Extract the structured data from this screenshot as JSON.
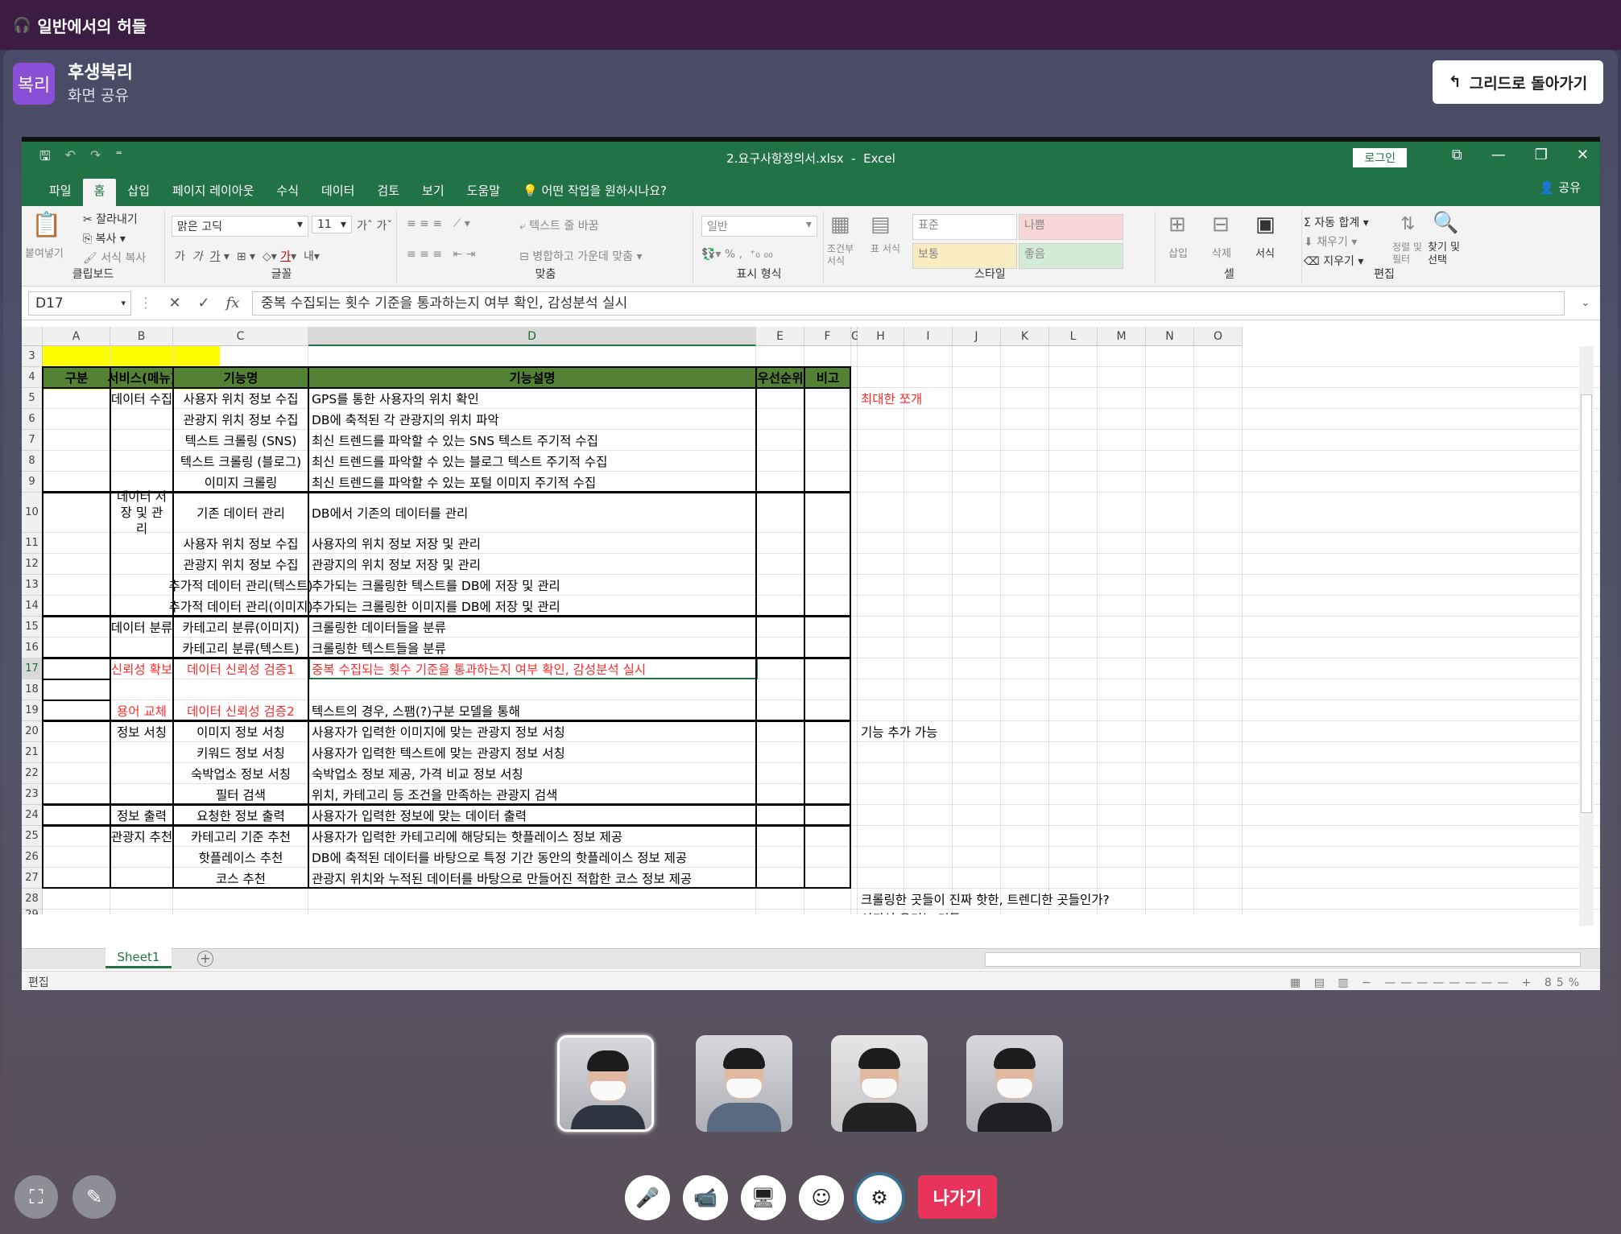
{
  "meeting": {
    "channel_title": "일반에서의 허들",
    "presenter_avatar": "복리",
    "presenter_name": "후생복리",
    "presenter_sub": "화면 공유",
    "back_button": "그리드로 돌아가기",
    "leave_button": "나가기"
  },
  "excel": {
    "filename": "2.요구사항정의서.xlsx",
    "app": "Excel",
    "login": "로그인",
    "tabs": [
      "파일",
      "홈",
      "삽입",
      "페이지 레이아웃",
      "수식",
      "데이터",
      "검토",
      "보기",
      "도움말"
    ],
    "active_tab": "홈",
    "tell_me": "어떤 작업을 원하시나요?",
    "share": "공유",
    "ribbon": {
      "paste": "붙여넣기",
      "cut": "잘라내기",
      "copy": "복사",
      "format_painter": "서식 복사",
      "font_name": "맑은 고딕",
      "font_size": "11",
      "wrap": "텍스트 줄 바꿈",
      "merge": "병합하고 가운데 맞춤",
      "number_format": "일반",
      "cond_format": "조건부 서식",
      "table_format": "표 서식",
      "styles": [
        "표준",
        "나쁨",
        "보통",
        "좋음"
      ],
      "insert": "삽입",
      "delete": "삭제",
      "format": "서식",
      "autosum": "자동 합계",
      "fill": "채우기",
      "clear": "지우기",
      "sort": "정렬 및 필터",
      "find": "찾기 및 선택",
      "groups": [
        "클립보드",
        "글꼴",
        "맞춤",
        "표시 형식",
        "스타일",
        "셀",
        "편집"
      ]
    },
    "name_box": "D17",
    "formula": "중복 수집되는 횟수 기준을 통과하는지 여부 확인, 감성분석 실시",
    "columns": [
      "A",
      "B",
      "C",
      "D",
      "E",
      "F",
      "G",
      "H",
      "I",
      "J",
      "K",
      "L",
      "M",
      "N",
      "O"
    ],
    "rows": [
      "3",
      "4",
      "5",
      "6",
      "7",
      "8",
      "9",
      "10",
      "11",
      "12",
      "13",
      "14",
      "15",
      "16",
      "17",
      "18",
      "19",
      "20",
      "21",
      "22",
      "23",
      "24",
      "25",
      "26",
      "27",
      "28",
      "29"
    ],
    "headers": [
      "구분",
      "서비스(메뉴)",
      "기능명",
      "기능설명",
      "우선순위",
      "비고"
    ],
    "categories": [
      {
        "label": "데이터 수집"
      },
      {
        "label": "데이터 저장 및 관리"
      },
      {
        "label": "데이터 분류"
      },
      {
        "label": "신뢰성 확보"
      },
      {
        "label": "용어 교체"
      },
      {
        "label": "정보 서칭"
      },
      {
        "label": "정보 출력"
      },
      {
        "label": "관광지 추천"
      }
    ],
    "features": [
      {
        "name": "사용자 위치 정보 수집",
        "desc": "GPS를 통한 사용자의 위치 확인"
      },
      {
        "name": "관광지 위치 정보 수집",
        "desc": "DB에 축적된 각 관광지의 위치 파악"
      },
      {
        "name": "텍스트 크롤링 (SNS)",
        "desc": "최신 트렌드를 파악할 수 있는 SNS 텍스트 주기적 수집"
      },
      {
        "name": "텍스트 크롤링 (블로그)",
        "desc": "최신 트렌드를 파악할 수 있는 블로그 텍스트 주기적 수집"
      },
      {
        "name": "이미지 크롤링",
        "desc": "최신 트렌드를 파악할 수 있는 포털 이미지 주기적 수집"
      },
      {
        "name": "기존 데이터 관리",
        "desc": "DB에서 기존의 데이터를 관리"
      },
      {
        "name": "사용자 위치 정보 수집",
        "desc": "사용자의 위치 정보 저장 및 관리"
      },
      {
        "name": "관광지 위치 정보 수집",
        "desc": "관광지의 위치 정보 저장 및 관리"
      },
      {
        "name": "추가적 데이터 관리(텍스트)",
        "desc": "추가되는 크롤링한 텍스트를 DB에 저장 및 관리"
      },
      {
        "name": "추가적 데이터 관리(이미지)",
        "desc": "추가되는 크롤링한 이미지를 DB에 저장 및 관리"
      },
      {
        "name": "카테고리 분류(이미지)",
        "desc": "크롤링한 데이터들을 분류"
      },
      {
        "name": "카테고리 분류(텍스트)",
        "desc": "크롤링한 텍스트들을 분류"
      },
      {
        "name": "데이터 신뢰성 검증1",
        "desc": "중복 수집되는 횟수 기준을 통과하는지 여부 확인, 감성분석 실시"
      },
      {
        "name": "데이터 신뢰성 검증2",
        "desc": "텍스트의 경우, 스팸(?)구분 모델을 통해"
      },
      {
        "name": "이미지 정보 서칭",
        "desc": "사용자가 입력한 이미지에 맞는 관광지 정보 서칭"
      },
      {
        "name": "키워드 정보 서칭",
        "desc": "사용자가 입력한 텍스트에 맞는 관광지 정보 서칭"
      },
      {
        "name": "숙박업소 정보 서칭",
        "desc": "숙박업소 정보 제공, 가격 비교 정보 서칭"
      },
      {
        "name": "필터 검색",
        "desc": "위치, 카테고리 등 조건을 만족하는 관광지 검색"
      },
      {
        "name": "요청한 정보 출력",
        "desc": "사용자가 입력한 정보에 맞는 데이터 출력"
      },
      {
        "name": "카테고리 기준 추천",
        "desc": "사용자가 입력한 카테고리에 해당되는 핫플레이스 정보 제공"
      },
      {
        "name": "핫플레이스 추천",
        "desc": "DB에 축적된 데이터를 바탕으로 특정 기간 동안의 핫플레이스 정보 제공"
      },
      {
        "name": "코스 추천",
        "desc": "관광지 위치와 누적된 데이터를 바탕으로 만들어진 적합한 코스 정보 제공"
      }
    ],
    "notes": {
      "h5": "최대한 쪼개",
      "h20": "기능 추가 가능",
      "h28": "크롤링한 곳들이 진짜 핫한, 트렌디한 곳들인가?",
      "h29": "신뢰성 올리는 것들"
    },
    "sheet_tab": "Sheet1",
    "status": "편집",
    "zoom": "85%"
  },
  "participants": [
    {
      "name": "participant-1",
      "active": true
    },
    {
      "name": "participant-2",
      "active": false
    },
    {
      "name": "participant-3",
      "active": false
    },
    {
      "name": "participant-4",
      "active": false
    }
  ],
  "colors": {
    "excel_green": "#217346",
    "header_green": "#548235",
    "highlight_yellow": "#ffff00",
    "leave_red": "#e8335a",
    "top_bar": "#3b1d44"
  }
}
